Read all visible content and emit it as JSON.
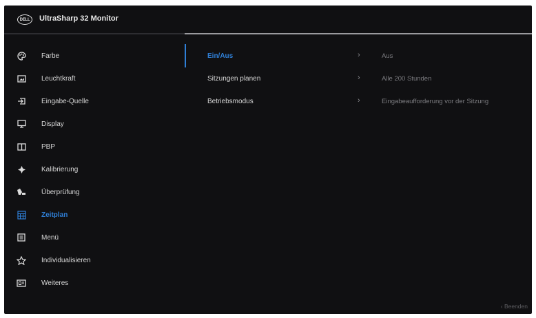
{
  "header": {
    "logo_text": "DELL",
    "title": "UltraSharp 32 Monitor"
  },
  "sidebar": {
    "items": [
      {
        "label": "Farbe",
        "icon": "palette-icon"
      },
      {
        "label": "Leuchtkraft",
        "icon": "brightness-icon"
      },
      {
        "label": "Eingabe-Quelle",
        "icon": "input-source-icon"
      },
      {
        "label": "Display",
        "icon": "display-icon"
      },
      {
        "label": "PBP",
        "icon": "pbp-icon"
      },
      {
        "label": "Kalibrierung",
        "icon": "calibration-icon"
      },
      {
        "label": "Überprüfung",
        "icon": "validation-icon"
      },
      {
        "label": "Zeitplan",
        "icon": "calendar-icon"
      },
      {
        "label": "Menü",
        "icon": "menu-icon"
      },
      {
        "label": "Individualisieren",
        "icon": "star-icon"
      },
      {
        "label": "Weiteres",
        "icon": "others-icon"
      }
    ],
    "active_index": 7
  },
  "content": {
    "rows": [
      {
        "label": "Ein/Aus",
        "value": "Aus"
      },
      {
        "label": "Sitzungen planen",
        "value": "Alle 200 Stunden"
      },
      {
        "label": "Betriebsmodus",
        "value": "Eingabeaufforderung vor der Sitzung"
      }
    ],
    "active_index": 0
  },
  "footer": {
    "text": "‹ Beenden"
  },
  "colors": {
    "background": "#101012",
    "accent": "#2f7fd6",
    "text": "#d8d8d8",
    "muted": "#7c7c80"
  }
}
